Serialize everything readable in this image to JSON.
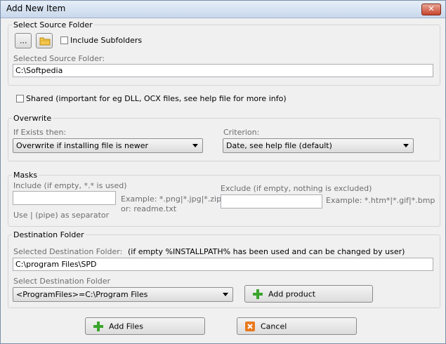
{
  "window": {
    "title": "Add New Item",
    "close_symbol": "✕"
  },
  "source": {
    "legend": "Select Source Folder",
    "browse_label": "...",
    "include_subfolders_label": "Include Subfolders",
    "selected_label": "Selected Source Folder:",
    "selected_value": "C:\\Softpedia"
  },
  "shared_label": "Shared (important for eg DLL, OCX files, see help file for more info)",
  "overwrite": {
    "legend": "Overwrite",
    "if_exists_label": "If Exists then:",
    "if_exists_value": "Overwrite if installing file is newer",
    "criterion_label": "Criterion:",
    "criterion_value": "Date, see help file (default)"
  },
  "masks": {
    "legend": "Masks",
    "include_label": "Include (if empty, *.* is used)",
    "include_value": "",
    "include_example": "Example: *.png|*.jpg|*.zip",
    "include_example_or": "or:  readme.txt",
    "separator_note": "Use | (pipe) as separator",
    "exclude_label": "Exclude (if empty, nothing is excluded)",
    "exclude_value": "",
    "exclude_example": "Example: *.htm*|*.gif|*.bmp"
  },
  "destination": {
    "legend": "Destination Folder",
    "selected_label": "Selected Destination Folder:",
    "note": "(if empty %INSTALLPATH% has been used and can be changed by user)",
    "selected_value": "C:\\program Files\\SPD",
    "select_label": "Select Destination Folder",
    "select_value": "<ProgramFiles>=C:\\Program Files",
    "add_product_label": "Add product"
  },
  "footer": {
    "add_files_label": "Add Files",
    "cancel_label": "Cancel"
  },
  "colors": {
    "plus_green": "#3aa52b",
    "cancel_orange": "#e87a1e",
    "folder_yellow": "#f3c54a"
  }
}
